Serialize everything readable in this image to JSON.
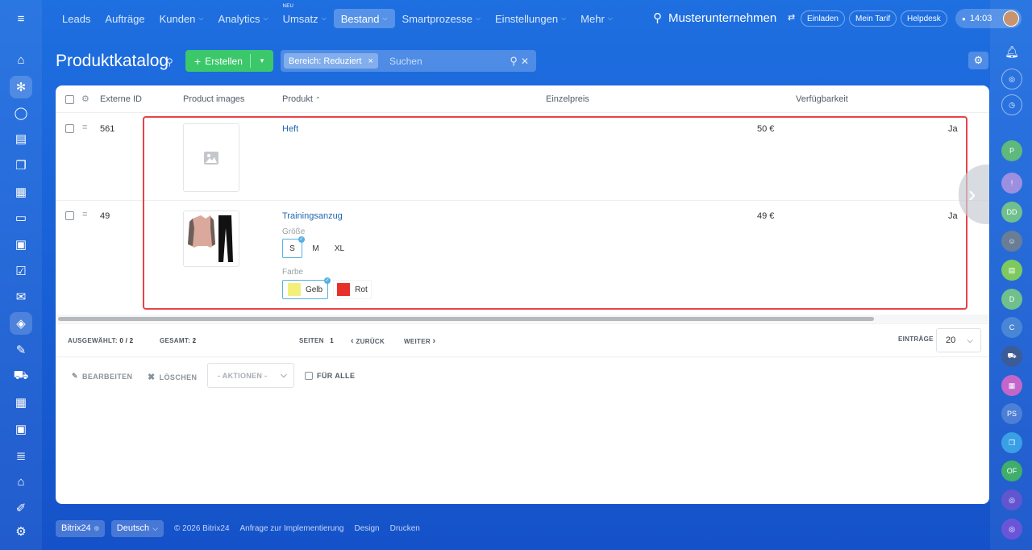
{
  "nav": {
    "menu_icon": "hamburger-icon",
    "items": [
      {
        "label": "Leads",
        "dropdown": false
      },
      {
        "label": "Aufträge",
        "dropdown": false
      },
      {
        "label": "Kunden",
        "dropdown": true
      },
      {
        "label": "Analytics",
        "dropdown": true
      },
      {
        "label": "Umsatz",
        "dropdown": true,
        "badge": "NEU"
      },
      {
        "label": "Bestand",
        "dropdown": true,
        "active": true
      },
      {
        "label": "Smartprozesse",
        "dropdown": true
      },
      {
        "label": "Einstellungen",
        "dropdown": true
      },
      {
        "label": "Mehr",
        "dropdown": true
      }
    ],
    "chevron": "⌵"
  },
  "header": {
    "company": "Musterunternehmen",
    "invite": "Einladen",
    "tariff": "Mein Tarif",
    "helpdesk": "Helpdesk",
    "time": "14:03"
  },
  "page": {
    "title": "Produktkatalog",
    "create_label": "Erstellen",
    "filter_tag": "Bereich: Reduziert",
    "search_placeholder": "Suchen"
  },
  "table": {
    "columns": {
      "external_id": "Externe ID",
      "images": "Product images",
      "product": "Produkt",
      "price": "Einzelpreis",
      "availability": "Verfügbarkeit"
    },
    "rows": [
      {
        "id": "561",
        "name": "Heft",
        "price": "50 €",
        "availability": "Ja"
      },
      {
        "id": "49",
        "name": "Trainingsanzug",
        "price": "49 €",
        "availability": "Ja",
        "size_label": "Größe",
        "sizes": [
          "S",
          "M",
          "XL"
        ],
        "selected_size": "S",
        "color_label": "Farbe",
        "colors": [
          {
            "name": "Gelb",
            "hex": "#f3ef7a"
          },
          {
            "name": "Rot",
            "hex": "#e8302a"
          }
        ]
      }
    ]
  },
  "pagination": {
    "selected_label": "AUSGEWÄHLT:",
    "selected_value": "0 / 2",
    "total_label": "GESAMT:",
    "total_value": "2",
    "pages_label": "SEITEN",
    "page": "1",
    "back": "ZURÜCK",
    "next": "WEITER",
    "entries_label": "EINTRÄGE",
    "entries_value": "20"
  },
  "actions": {
    "edit": "BEARBEITEN",
    "delete": "LÖSCHEN",
    "select": "- AKTIONEN -",
    "for_all": "FÜR ALLE"
  },
  "footer": {
    "brand": "Bitrix24",
    "language": "Deutsch",
    "copyright": "© 2026 Bitrix24",
    "impl": "Anfrage zur Implementierung",
    "design": "Design",
    "print": "Drucken"
  },
  "right_avatars": [
    "P",
    "DD",
    "D",
    "C",
    "PS",
    "OF"
  ],
  "colors": {
    "accent": "#2067b0",
    "create": "#3bc86a",
    "highlight": "#e8424a"
  }
}
